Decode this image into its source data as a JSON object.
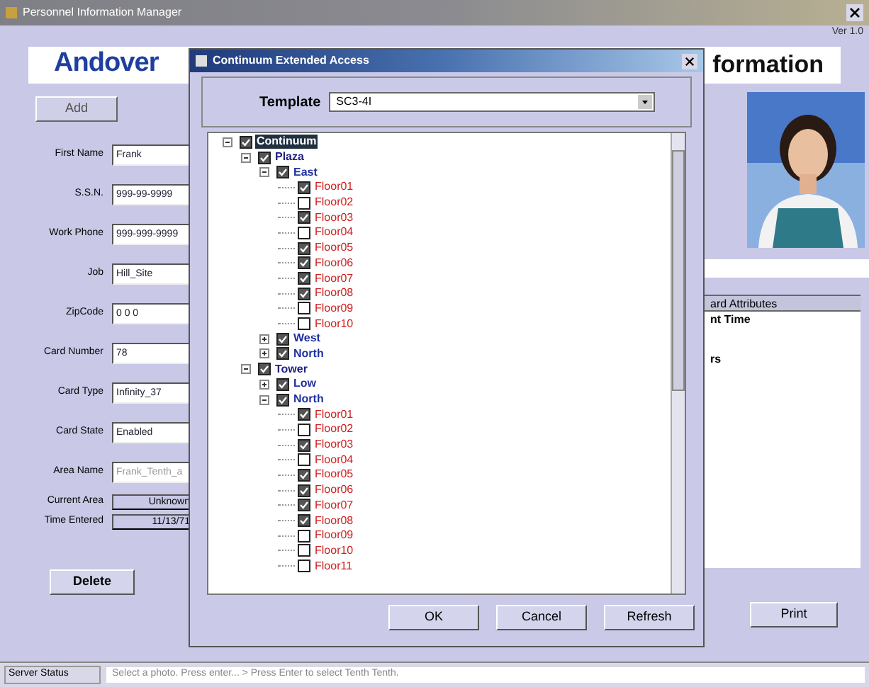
{
  "window": {
    "title": "Personnel Information Manager",
    "version": "Ver 1.0"
  },
  "header": {
    "left": "Andover",
    "right": "formation"
  },
  "top_button": "Add",
  "fields": [
    {
      "label": "First Name",
      "value": "Frank",
      "disabled": false
    },
    {
      "label": "S.S.N.",
      "value": "999-99-9999",
      "disabled": false
    },
    {
      "label": "Work Phone",
      "value": "999-999-9999",
      "disabled": false
    },
    {
      "label": "Job",
      "value": "Hill_Site",
      "disabled": false
    },
    {
      "label": "ZipCode",
      "value": "0 0 0",
      "disabled": false
    },
    {
      "label": "Card Number",
      "value": "78",
      "disabled": false
    },
    {
      "label": "Card Type",
      "value": "Infinity_37",
      "disabled": false
    },
    {
      "label": "Card State",
      "value": "Enabled",
      "disabled": false
    },
    {
      "label": "Area Name",
      "value": "Frank_Tenth_a",
      "disabled": true
    }
  ],
  "readouts": [
    {
      "label": "Current Area",
      "value": "Unknown"
    },
    {
      "label": "Time Entered",
      "value": "11/13/71"
    }
  ],
  "delete_button": "Delete",
  "attributes": {
    "header": "ard Attributes",
    "rows": [
      "nt Time",
      "rs"
    ]
  },
  "print_button": "Print",
  "status_bar": {
    "label": "Server Status",
    "message": "Select a photo. Press enter... > Press Enter to select Tenth Tenth."
  },
  "dialog": {
    "title": "Continuum Extended Access",
    "template_label": "Template",
    "template_value": "SC3-4I",
    "tree": [
      {
        "label": "Continuum",
        "selected": true,
        "checked": true,
        "expanded": true,
        "children": [
          {
            "label": "Plaza",
            "selected": false,
            "checked": true,
            "expanded": true,
            "children": [
              {
                "label": "East",
                "selected": false,
                "checked": true,
                "expanded": true,
                "children": [
                  {
                    "label": "Floor01",
                    "selected": false,
                    "checked": true
                  },
                  {
                    "label": "Floor02",
                    "selected": false,
                    "checked": false
                  },
                  {
                    "label": "Floor03",
                    "selected": false,
                    "checked": true
                  },
                  {
                    "label": "Floor04",
                    "selected": false,
                    "checked": false
                  },
                  {
                    "label": "Floor05",
                    "selected": false,
                    "checked": true
                  },
                  {
                    "label": "Floor06",
                    "selected": false,
                    "checked": true
                  },
                  {
                    "label": "Floor07",
                    "selected": false,
                    "checked": true
                  },
                  {
                    "label": "Floor08",
                    "selected": false,
                    "checked": true
                  },
                  {
                    "label": "Floor09",
                    "selected": false,
                    "checked": false
                  },
                  {
                    "label": "Floor10",
                    "selected": false,
                    "checked": false
                  }
                ]
              },
              {
                "label": "West",
                "selected": false,
                "checked": true,
                "expanded": false
              },
              {
                "label": "North",
                "selected": false,
                "checked": true,
                "expanded": false
              }
            ]
          },
          {
            "label": "Tower",
            "selected": false,
            "checked": true,
            "expanded": true,
            "children": [
              {
                "label": "Low",
                "selected": false,
                "checked": true,
                "expanded": false
              },
              {
                "label": "North",
                "selected": false,
                "checked": true,
                "expanded": true,
                "children": [
                  {
                    "label": "Floor01",
                    "selected": false,
                    "checked": true
                  },
                  {
                    "label": "Floor02",
                    "selected": false,
                    "checked": false
                  },
                  {
                    "label": "Floor03",
                    "selected": false,
                    "checked": true
                  },
                  {
                    "label": "Floor04",
                    "selected": false,
                    "checked": false
                  },
                  {
                    "label": "Floor05",
                    "selected": false,
                    "checked": true
                  },
                  {
                    "label": "Floor06",
                    "selected": false,
                    "checked": true
                  },
                  {
                    "label": "Floor07",
                    "selected": false,
                    "checked": true
                  },
                  {
                    "label": "Floor08",
                    "selected": false,
                    "checked": true
                  },
                  {
                    "label": "Floor09",
                    "selected": false,
                    "checked": false
                  },
                  {
                    "label": "Floor10",
                    "selected": false,
                    "checked": false
                  },
                  {
                    "label": "Floor11",
                    "selected": false,
                    "checked": false
                  }
                ]
              }
            ]
          }
        ]
      }
    ],
    "buttons": [
      "OK",
      "Cancel",
      "Refresh"
    ]
  }
}
